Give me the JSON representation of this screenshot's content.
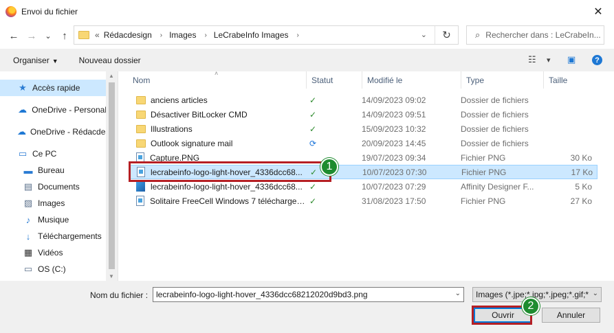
{
  "window": {
    "title": "Envoi du fichier",
    "close": "✕"
  },
  "nav": {
    "back": "←",
    "forward": "→",
    "recent": "⌄",
    "up": "↑"
  },
  "address": {
    "prefix": "«",
    "crumbs": [
      "Rédacdesign",
      "Images",
      "LeCrabeInfo Images"
    ],
    "sep": "›",
    "dropdown": "⌄",
    "refresh": "↻"
  },
  "search": {
    "placeholder": "Rechercher dans : LeCrabeIn...",
    "icon": "⌕"
  },
  "toolbar": {
    "organize": "Organiser",
    "organize_caret": "▼",
    "new_folder": "Nouveau dossier",
    "view_icon": "☷",
    "view_caret": "▾",
    "preview_icon": "▣",
    "help_icon": "?"
  },
  "sidebar": {
    "items": [
      {
        "label": "Accès rapide",
        "icon": "★",
        "color": "#2b7cd3"
      },
      {
        "label": "OneDrive - Personal",
        "icon": "☁",
        "color": "#1e78d4"
      },
      {
        "label": "OneDrive - Rédacdesi",
        "icon": "☁",
        "color": "#1e78d4"
      },
      {
        "label": "Ce PC",
        "icon": "▭",
        "color": "#2b7cd3"
      },
      {
        "label": "Bureau",
        "icon": "▬",
        "color": "#2b7cd3"
      },
      {
        "label": "Documents",
        "icon": "▤",
        "color": "#5a6f8a"
      },
      {
        "label": "Images",
        "icon": "▨",
        "color": "#5a6f8a"
      },
      {
        "label": "Musique",
        "icon": "♪",
        "color": "#2b7cd3"
      },
      {
        "label": "Téléchargements",
        "icon": "↓",
        "color": "#2b7cd3"
      },
      {
        "label": "Vidéos",
        "icon": "▦",
        "color": "#333333"
      },
      {
        "label": "OS (C:)",
        "icon": "▭",
        "color": "#5a6f8a"
      }
    ],
    "scroll_up": "▲",
    "scroll_down": "▼"
  },
  "columns": {
    "name": "Nom",
    "status": "Statut",
    "modified": "Modifié le",
    "type": "Type",
    "size": "Taille",
    "sort_caret": "˄"
  },
  "files": [
    {
      "name": "anciens articles",
      "kind": "folder",
      "status": "✓",
      "status_kind": "ok",
      "modified": "14/09/2023 09:02",
      "type": "Dossier de fichiers",
      "size": ""
    },
    {
      "name": "Désactiver BitLocker CMD",
      "kind": "folder",
      "status": "✓",
      "status_kind": "ok",
      "modified": "14/09/2023 09:51",
      "type": "Dossier de fichiers",
      "size": ""
    },
    {
      "name": "Illustrations",
      "kind": "folder",
      "status": "✓",
      "status_kind": "ok",
      "modified": "15/09/2023 10:32",
      "type": "Dossier de fichiers",
      "size": ""
    },
    {
      "name": "Outlook signature mail",
      "kind": "folder",
      "status": "⟳",
      "status_kind": "sync",
      "modified": "20/09/2023 14:45",
      "type": "Dossier de fichiers",
      "size": ""
    },
    {
      "name": "Capture.PNG",
      "kind": "png",
      "status": "",
      "status_kind": "none",
      "modified": "19/07/2023 09:34",
      "type": "Fichier PNG",
      "size": "30 Ko"
    },
    {
      "name": "lecrabeinfo-logo-light-hover_4336dcc68...",
      "kind": "png",
      "status": "✓",
      "status_kind": "ok",
      "modified": "10/07/2023 07:30",
      "type": "Fichier PNG",
      "size": "17 Ko",
      "selected": true
    },
    {
      "name": "lecrabeinfo-logo-light-hover_4336dcc68...",
      "kind": "afdesign",
      "status": "✓",
      "status_kind": "ok",
      "modified": "10/07/2023 07:29",
      "type": "Affinity Designer F...",
      "size": "5 Ko"
    },
    {
      "name": "Solitaire FreeCell Windows 7 téléchargem...",
      "kind": "png",
      "status": "✓",
      "status_kind": "ok",
      "modified": "31/08/2023 17:50",
      "type": "Fichier PNG",
      "size": "27 Ko"
    }
  ],
  "bottom": {
    "filename_label": "Nom du fichier :",
    "filename_value": "lecrabeinfo-logo-light-hover_4336dcc68212020d9bd3.png",
    "filetype_value": "Images (*.jpe;*.jpg;*.jpeg;*.gif;*",
    "chev": "⌄",
    "open_label": "Ouvrir",
    "cancel_label": "Annuler"
  },
  "annotations": {
    "badge1": "1",
    "badge2": "2",
    "color": "#b51f24",
    "badge_color": "#1e8c2f"
  }
}
